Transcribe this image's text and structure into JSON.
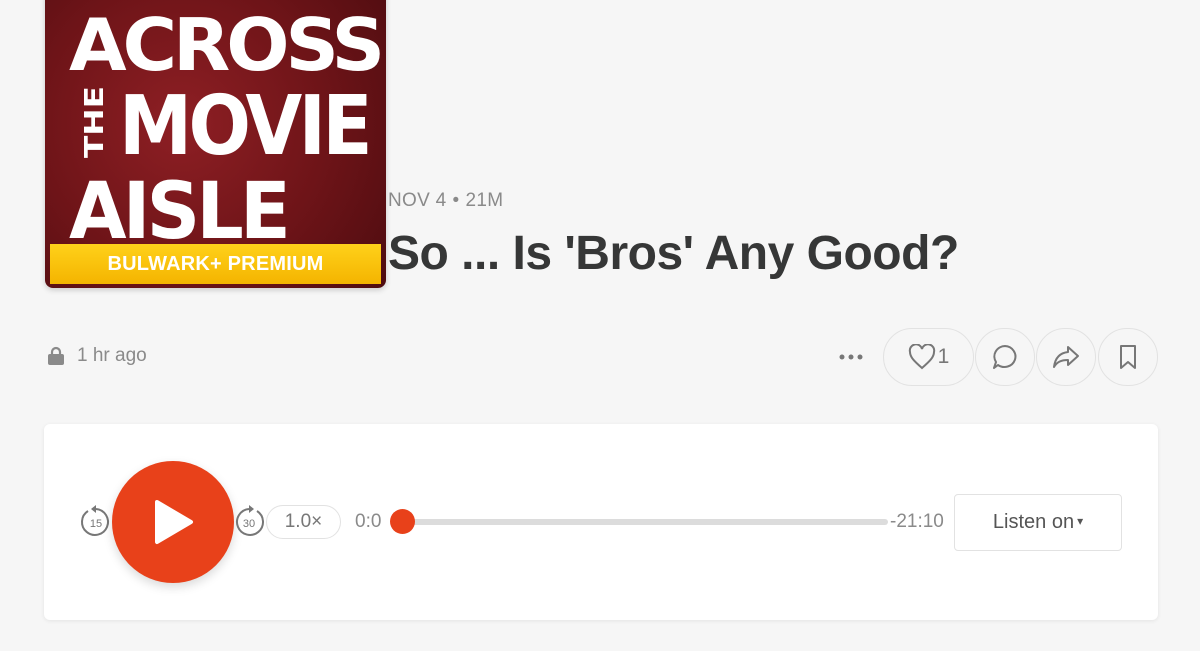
{
  "cover": {
    "line1": "ACROSS",
    "line_side": "THE",
    "line2": "MOVIE",
    "line3": "AISLE",
    "banner": "BULWARK+ PREMIUM"
  },
  "episode": {
    "date": "NOV 4",
    "separator": "•",
    "duration": "21M",
    "title": "So ... Is 'Bros' Any Good?"
  },
  "post": {
    "posted_ago": "1 hr ago",
    "like_count": "1"
  },
  "player": {
    "skip_back_label": "15",
    "skip_forward_label": "30",
    "speed": "1.0×",
    "current_time": "0:0",
    "remaining_time": "-21:10",
    "progress_fraction": 0,
    "listen_on": "Listen on",
    "listen_caret": "▾"
  },
  "colors": {
    "accent": "#e8411a",
    "banner": "#f4b400",
    "cover_bg": "#6e1418"
  }
}
